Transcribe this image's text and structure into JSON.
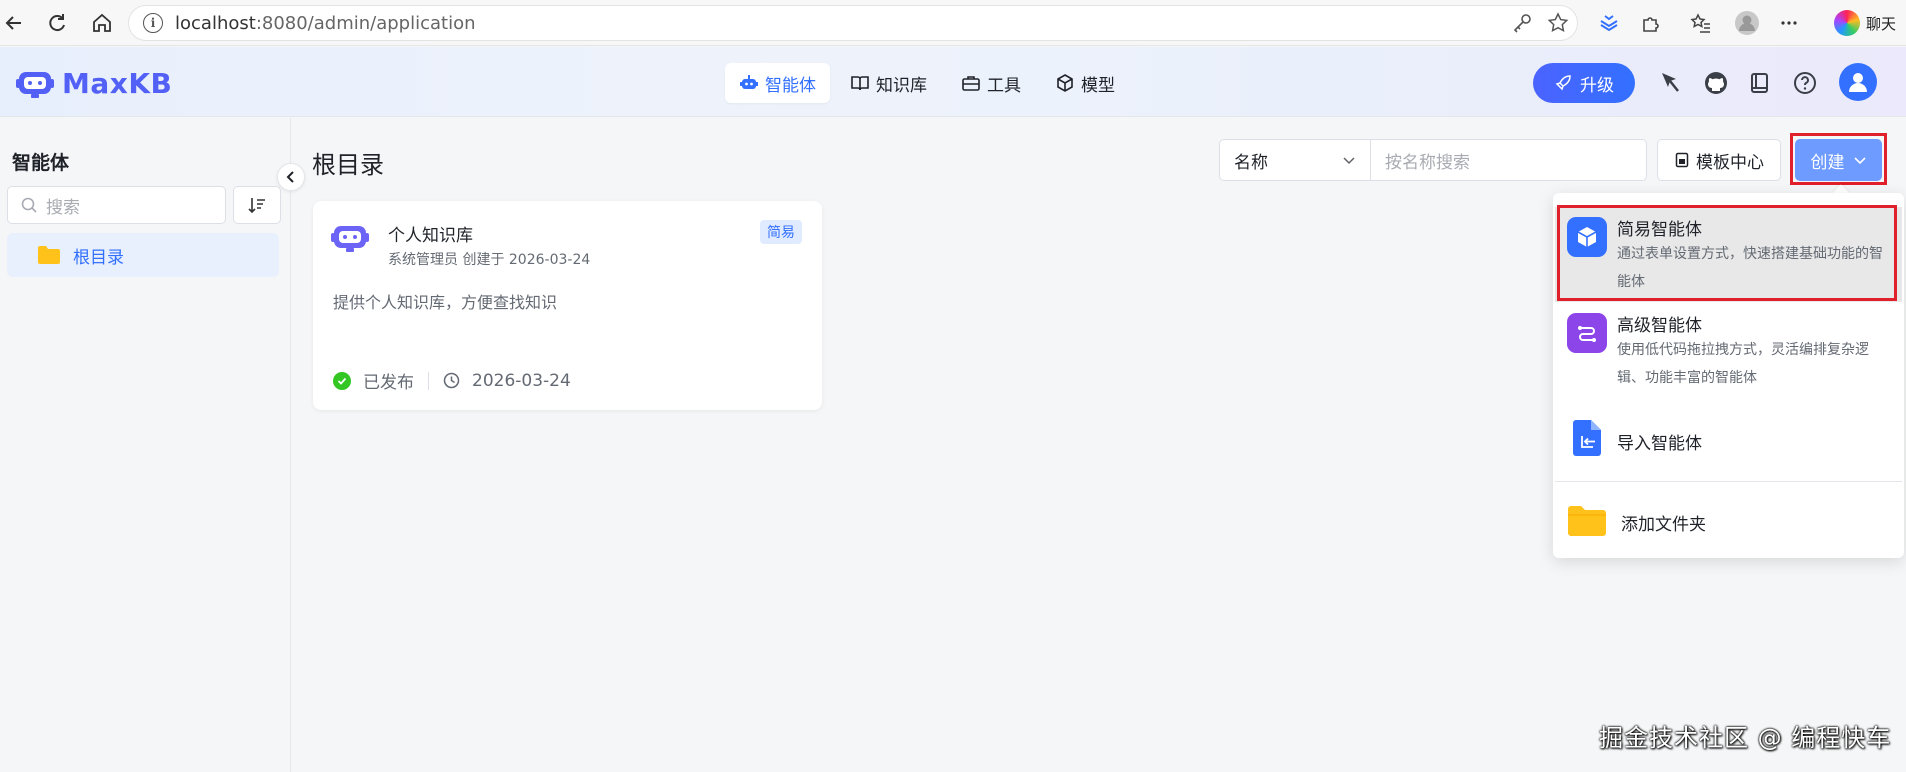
{
  "browser": {
    "url_host": "localhost",
    "url_rest": ":8080/admin/application",
    "chat_label": "聊天"
  },
  "app": {
    "logo_text": "MaxKB",
    "nav": [
      {
        "label": "智能体",
        "active": true
      },
      {
        "label": "知识库"
      },
      {
        "label": "工具"
      },
      {
        "label": "模型"
      }
    ],
    "upgrade_label": "升级"
  },
  "sidebar": {
    "title": "智能体",
    "search_placeholder": "搜索",
    "folder_label": "根目录"
  },
  "main": {
    "title": "根目录",
    "filter_select": "名称",
    "search_placeholder": "按名称搜索",
    "template_center": "模板中心",
    "create_label": "创建"
  },
  "card": {
    "title": "个人知识库",
    "meta": "系统管理员  创建于 2026-03-24",
    "tag": "简易",
    "desc": "提供个人知识库，方便查找知识",
    "status": "已发布",
    "date": "2026-03-24"
  },
  "dropdown": {
    "simple_title": "简易智能体",
    "simple_desc": "通过表单设置方式，快速搭建基础功能的智能体",
    "advanced_title": "高级智能体",
    "advanced_desc": "使用低代码拖拉拽方式，灵活编排复杂逻辑、功能丰富的智能体",
    "import_title": "导入智能体",
    "folder_title": "添加文件夹"
  },
  "watermark": "掘金技术社区 @ 编程快车",
  "colors": {
    "accent": "#3370ff",
    "logo": "#5360f5",
    "highlight": "#e0202a",
    "published": "#34c724",
    "folder": "#ffc21a"
  }
}
